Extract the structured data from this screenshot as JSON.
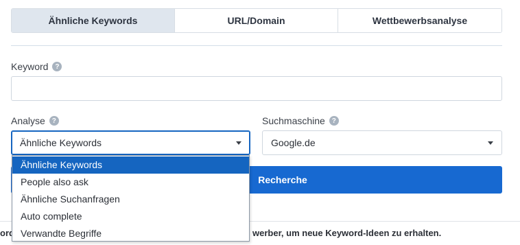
{
  "tabs": [
    {
      "label": "Ähnliche Keywords",
      "active": true
    },
    {
      "label": "URL/Domain",
      "active": false
    },
    {
      "label": "Wettbewerbsanalyse",
      "active": false
    }
  ],
  "keyword": {
    "label": "Keyword",
    "value": "",
    "help": "?"
  },
  "analyse": {
    "label": "Analyse",
    "value": "Ähnliche Keywords",
    "help": "?"
  },
  "suchmaschine": {
    "label": "Suchmaschine",
    "value": "Google.de",
    "help": "?"
  },
  "search_button": {
    "label": "Recherche"
  },
  "hint": {
    "left": "ord",
    "right": "werber, um neue Keyword-Ideen zu erhalten."
  },
  "dropdown_options": [
    {
      "label": "Ähnliche Keywords",
      "selected": true
    },
    {
      "label": "People also ask",
      "selected": false
    },
    {
      "label": "Ähnliche Suchanfragen",
      "selected": false
    },
    {
      "label": "Auto complete",
      "selected": false
    },
    {
      "label": "Verwandte Begriffe",
      "selected": false
    }
  ],
  "colors": {
    "accent": "#1769d1",
    "selected_option": "#1565c0",
    "active_tab": "#dfe6ee"
  }
}
